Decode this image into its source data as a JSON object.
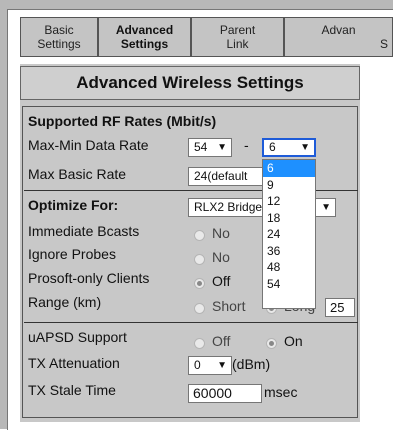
{
  "tabs": [
    {
      "line1": "Basic",
      "line2": "Settings"
    },
    {
      "line1": "Advanced",
      "line2": "Settings"
    },
    {
      "line1": "Parent",
      "line2": "Link"
    },
    {
      "line1": "Advan",
      "line2": "S"
    }
  ],
  "header": {
    "title": "Advanced Wireless Settings"
  },
  "rf": {
    "section": "Supported RF Rates (Mbit/s)",
    "max_min_label": "Max-Min Data Rate",
    "max_value": "54",
    "dash": "-",
    "min_value": "6",
    "max_basic_label": "Max Basic Rate",
    "max_basic_value": "24(default",
    "options": [
      "6",
      "9",
      "12",
      "18",
      "24",
      "36",
      "48",
      "54"
    ]
  },
  "optimize": {
    "label": "Optimize For:",
    "value": "RLX2 Bridge",
    "immediate_label": "Immediate Bcasts",
    "immediate_no": "No",
    "ignore_label": "Ignore Probes",
    "ignore_no": "No",
    "prosoft_label": "Prosoft-only Clients",
    "prosoft_off": "Off",
    "range_label": "Range (km)",
    "range_short": "Short",
    "range_long": "Long",
    "range_value": "25"
  },
  "apsd": {
    "label": "uAPSD Support",
    "off": "Off",
    "on": "On",
    "tx_att_label": "TX Attenuation",
    "tx_att_value": "0",
    "tx_att_unit": "(dBm)",
    "stale_label": "TX Stale Time",
    "stale_value": "60000",
    "stale_unit": "msec"
  }
}
